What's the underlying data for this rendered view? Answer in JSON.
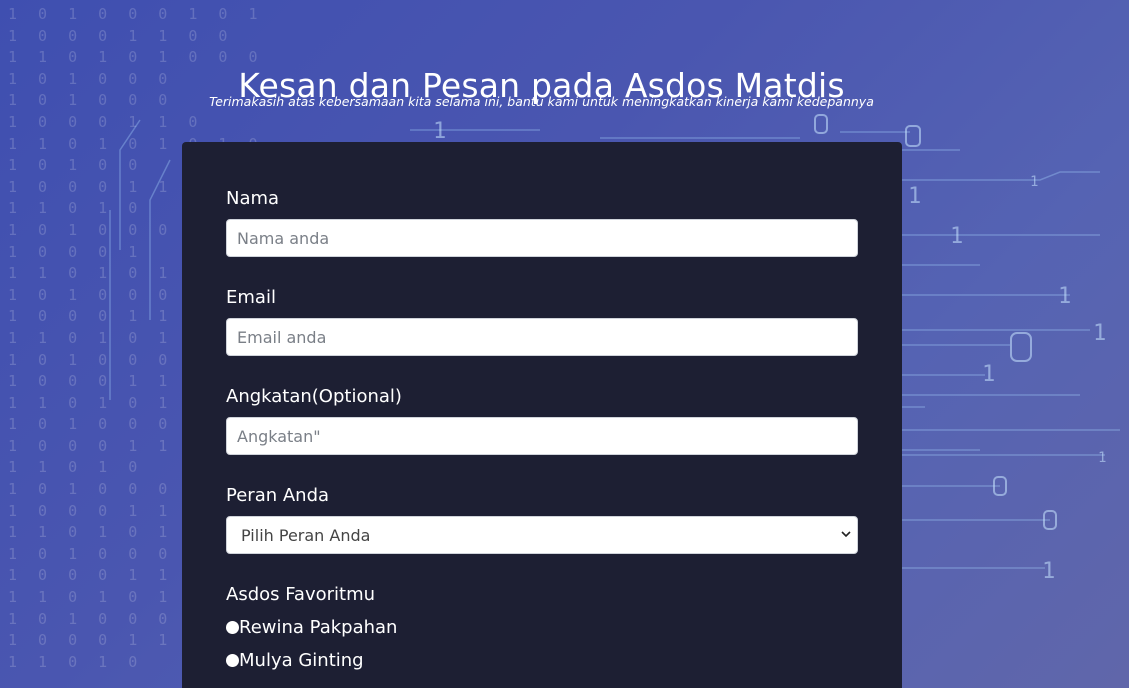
{
  "header": {
    "title": "Kesan dan Pesan pada Asdos Matdis",
    "subtitle": "Terimakasih atas kebersamaan kita selama ini, bantu kami untuk meningkatkan kinerja kami kedepannya"
  },
  "form": {
    "nama": {
      "label": "Nama",
      "placeholder": "Nama anda"
    },
    "email": {
      "label": "Email",
      "placeholder": "Email anda"
    },
    "angkatan": {
      "label": "Angkatan(Optional)",
      "placeholder": "Angkatan\""
    },
    "peran": {
      "label": "Peran Anda",
      "selected": "Pilih Peran Anda"
    },
    "asdos": {
      "label": "Asdos Favoritmu",
      "options": [
        "Rewina Pakpahan",
        "Mulya Ginting"
      ]
    }
  },
  "colors": {
    "card_bg": "#1d1f33",
    "page_bg": "#4a56b0"
  }
}
